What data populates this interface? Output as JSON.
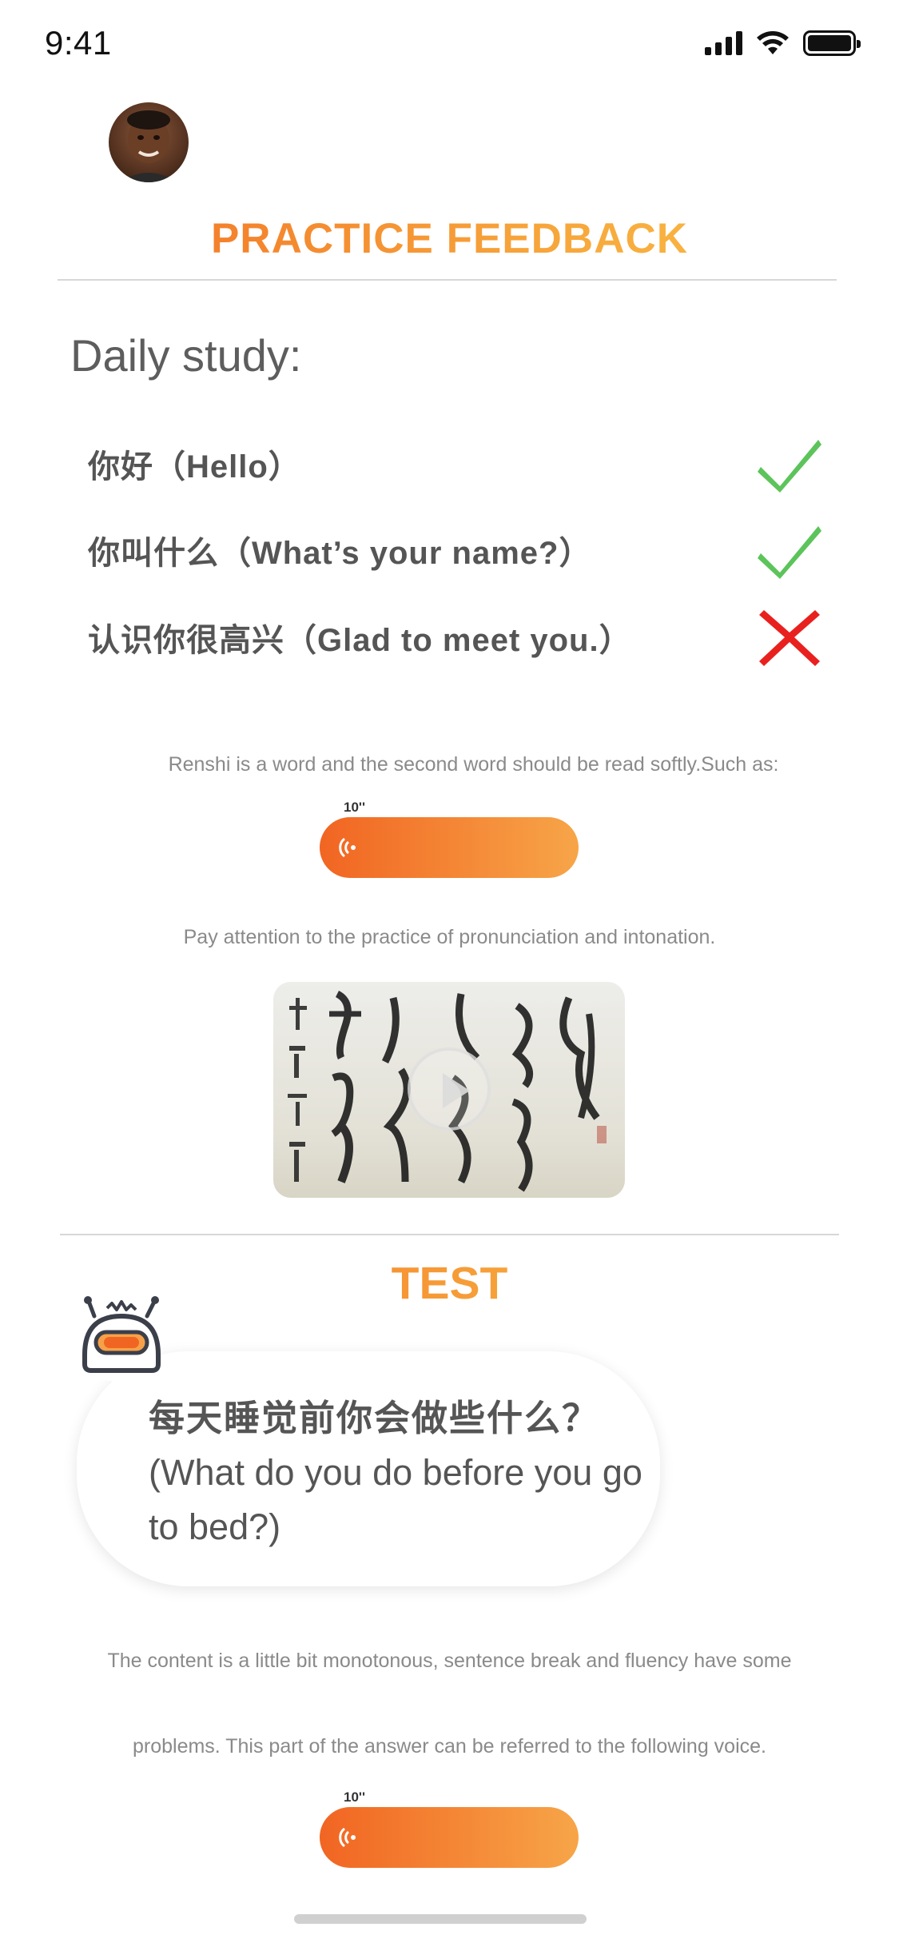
{
  "status_bar": {
    "time": "9:41"
  },
  "header": {
    "title": "PRACTICE FEEDBACK"
  },
  "daily_study": {
    "title": "Daily study:",
    "items": [
      {
        "label": "你好（Hello）",
        "result": "correct"
      },
      {
        "label": "你叫什么（What’s your name?）",
        "result": "correct"
      },
      {
        "label": "认识你很高兴（Glad to meet you.）",
        "result": "wrong"
      }
    ]
  },
  "feedback_note_1": "Renshi is a word and the second word should be read softly.Such as:",
  "voice_1": {
    "duration": "10''"
  },
  "feedback_note_2": "Pay attention to the practice of pronunciation and intonation.",
  "test": {
    "title": "TEST",
    "question_cn": "每天睡觉前你会做些什么？",
    "question_en": "(What do you do before you go to bed?)",
    "feedback_line_1": "The content is a little bit monotonous, sentence break and fluency have some",
    "feedback_line_2": "problems. This part of the answer can be referred to the following voice."
  },
  "voice_2": {
    "duration": "10''"
  },
  "colors": {
    "accent_start": "#f16522",
    "accent_end": "#f9c54a",
    "correct": "#5cc45a",
    "wrong": "#e8211f"
  },
  "icons": {
    "correct": "check-icon",
    "wrong": "cross-icon",
    "voice": "sound-wave-icon",
    "video": "play-icon",
    "robot": "robot-icon"
  }
}
